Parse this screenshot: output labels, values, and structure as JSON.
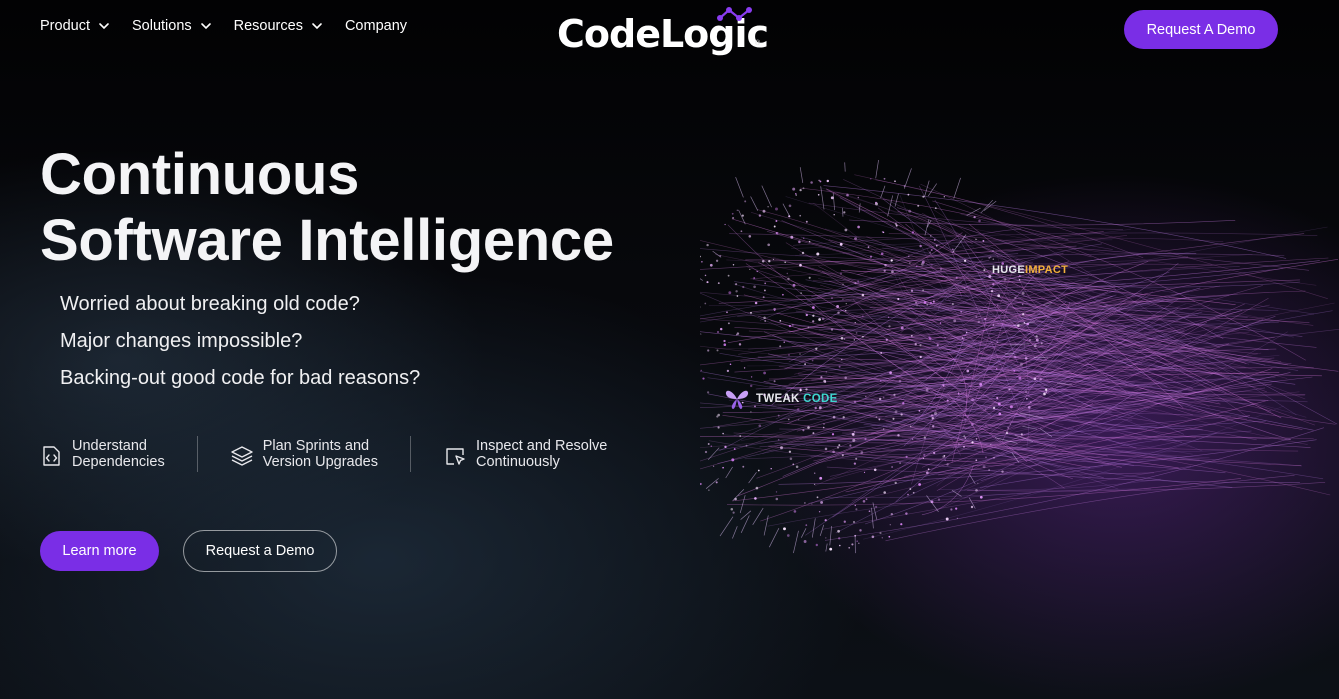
{
  "nav": {
    "items": [
      {
        "label": "Product",
        "has_dropdown": true,
        "icon": "chevron-down-icon"
      },
      {
        "label": "Solutions",
        "has_dropdown": true,
        "icon": "chevron-down-icon"
      },
      {
        "label": "Resources",
        "has_dropdown": true,
        "icon": "chevron-down-icon"
      },
      {
        "label": "Company",
        "has_dropdown": false
      }
    ],
    "logo_text": "CodeLogic",
    "logo_reg": "®",
    "cta_label": "Request A Demo"
  },
  "hero": {
    "title_line1": "Continuous",
    "title_line2": "Software Intelligence",
    "questions": [
      "Worried about breaking old code?",
      "Major changes impossible?",
      "Backing-out good code for bad reasons?"
    ]
  },
  "features": [
    {
      "line1": "Understand",
      "line2": "Dependencies",
      "icon": "code-brackets-icon"
    },
    {
      "line1": "Plan Sprints and",
      "line2": "Version Upgrades",
      "icon": "layers-icon"
    },
    {
      "line1": "Inspect and Resolve",
      "line2": "Continuously",
      "icon": "cursor-window-icon"
    }
  ],
  "cta": {
    "primary_label": "Learn more",
    "secondary_label": "Request a Demo"
  },
  "graphic": {
    "huge_white": "HUGE",
    "huge_accent": "IMPACT",
    "tweak_white": "TWEAK",
    "tweak_accent": "CODE",
    "tweak_icon": "butterfly-icon"
  },
  "colors": {
    "accent": "#7a2ee6",
    "impact": "#f2b13a",
    "code": "#3fd6d0",
    "background": "#05060a"
  }
}
